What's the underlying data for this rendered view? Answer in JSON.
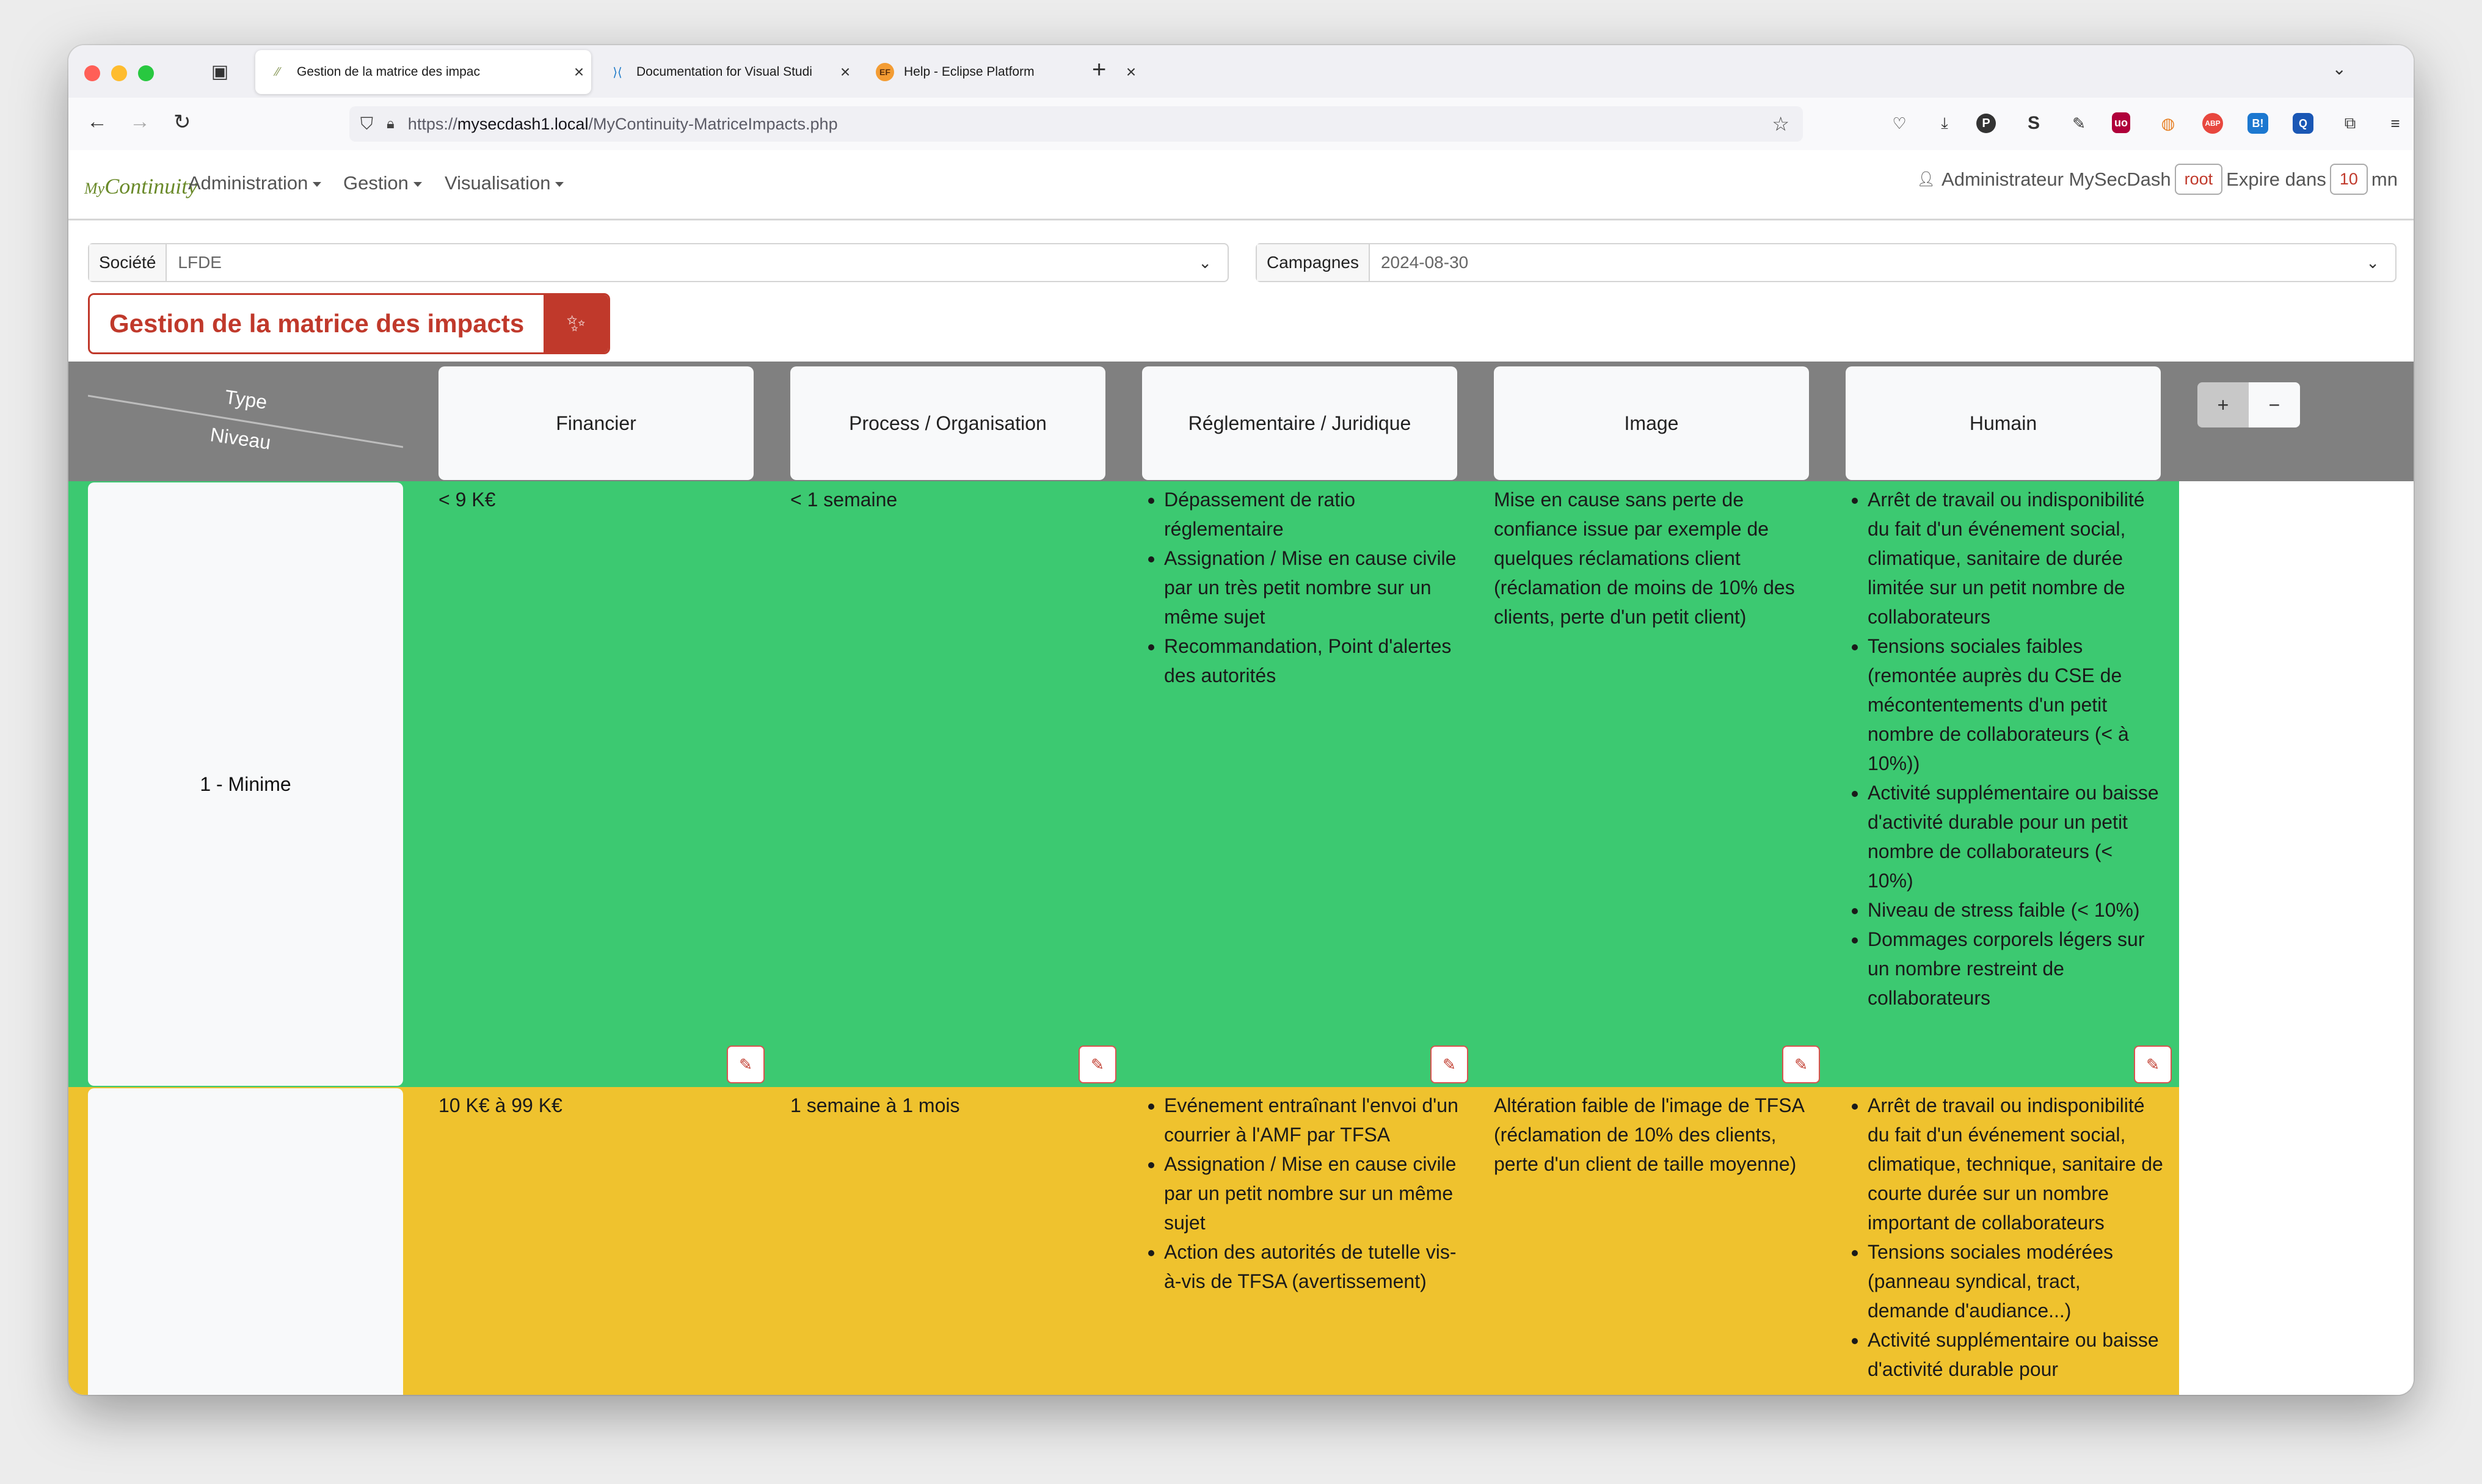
{
  "browser": {
    "tabs": [
      {
        "title": "Gestion de la matrice des impac",
        "active": true,
        "favicon": "mycontinuity-favicon"
      },
      {
        "title": "Documentation for Visual Studi",
        "active": false,
        "favicon": "vscode-icon"
      },
      {
        "title": "Help - Eclipse Platform",
        "active": false,
        "favicon": "eclipse-icon"
      }
    ],
    "url_prefix": "https://",
    "url_host": "mysecdash1.local",
    "url_path": "/MyContinuity-MatriceImpacts.php"
  },
  "app": {
    "logo_prefix": "My",
    "logo_main": "Continuity",
    "menus": [
      "Administration",
      "Gestion",
      "Visualisation"
    ],
    "user_name": "Administrateur MySecDash",
    "user_login": "root",
    "expire_label": "Expire dans",
    "expire_value": "10",
    "expire_unit": "mn"
  },
  "filters": {
    "societe_label": "Société",
    "societe_value": "LFDE",
    "campagnes_label": "Campagnes",
    "campagnes_value": "2024-08-30"
  },
  "page_title": "Gestion de la matrice des impacts",
  "matrix": {
    "corner_type": "Type",
    "corner_niveau": "Niveau",
    "columns": [
      "Financier",
      "Process / Organisation",
      "Réglementaire / Juridique",
      "Image",
      "Humain"
    ],
    "add_label": "+",
    "remove_label": "−",
    "rows": [
      {
        "level": "1 - Minime",
        "color": "#3cc971",
        "financier": "< 9 K€",
        "process": "< 1 semaine",
        "reglementaire": [
          "Dépassement de ratio réglementaire",
          "Assignation / Mise en cause civile par un très petit nombre sur un même sujet",
          "Recommandation, Point d'alertes des autorités"
        ],
        "image": "Mise en cause sans perte de confiance issue par exemple de quelques réclamations client (réclamation de moins de 10% des clients, perte d'un petit client)",
        "humain": [
          "Arrêt de travail ou indisponibilité du fait d'un événement social, climatique, sanitaire de durée limitée sur un petit nombre de collaborateurs",
          "Tensions sociales faibles (remontée auprès du CSE de mécontentements d'un petit nombre de collaborateurs (< à 10%))",
          "Activité supplémentaire ou baisse d'activité durable pour un petit nombre de collaborateurs (< 10%)",
          "Niveau de stress faible (< 10%)",
          "Dommages corporels légers sur un nombre restreint de collaborateurs"
        ]
      },
      {
        "level": "",
        "color": "#efc22e",
        "financier": "10 K€ à 99 K€",
        "process": "1 semaine à 1 mois",
        "reglementaire": [
          "Evénement entraînant l'envoi d'un courrier à l'AMF par TFSA",
          "Assignation / Mise en cause civile par un petit nombre sur un même sujet",
          "Action des autorités de tutelle vis-à-vis de TFSA (avertissement)"
        ],
        "image": "Altération faible de l'image de TFSA (réclamation de 10% des clients, perte d'un client de taille moyenne)",
        "humain": [
          "Arrêt de travail ou indisponibilité du fait d'un événement social, climatique, technique, sanitaire de courte durée sur un nombre important de collaborateurs",
          "Tensions sociales modérées (panneau syndical, tract, demande d'audiance...)",
          "Activité supplémentaire ou baisse d'activité durable pour"
        ]
      }
    ]
  }
}
